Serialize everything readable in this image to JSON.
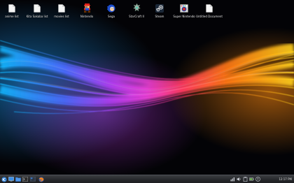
{
  "desktop": {
    "icons": [
      {
        "label": "anime list",
        "icon": "document-icon"
      },
      {
        "label": "Kita Sakaba list",
        "icon": "document-icon"
      },
      {
        "label": "movies list",
        "icon": "document-icon"
      },
      {
        "label": "Nintendo",
        "icon": "nintendo-mario-icon"
      },
      {
        "label": "Sega",
        "icon": "sega-sonic-icon"
      },
      {
        "label": "StarCraft II",
        "icon": "starcraft-icon"
      },
      {
        "label": "Steam",
        "icon": "steam-icon"
      },
      {
        "label": "Super Nintendo",
        "icon": "snes-icon"
      },
      {
        "label": "Untitled Document",
        "icon": "document-icon"
      }
    ]
  },
  "taskbar": {
    "launchers": [
      "kde-menu-icon",
      "show-desktop-icon",
      "file-manager-icon",
      "terminal-icon",
      "browser-icon",
      "pager-icon"
    ],
    "tray": [
      "network-icon",
      "volume-icon",
      "clipboard-icon",
      "battery-icon",
      "notifications-icon"
    ],
    "clock": "12:17 PM"
  },
  "colors": {
    "taskbar_bg": "#2a2c30",
    "icon_label": "#e9e9e9",
    "wave_blue": "#19a6ff",
    "wave_magenta": "#e23df0",
    "wave_orange": "#ff7a10",
    "wave_yellow": "#ffd21c"
  }
}
